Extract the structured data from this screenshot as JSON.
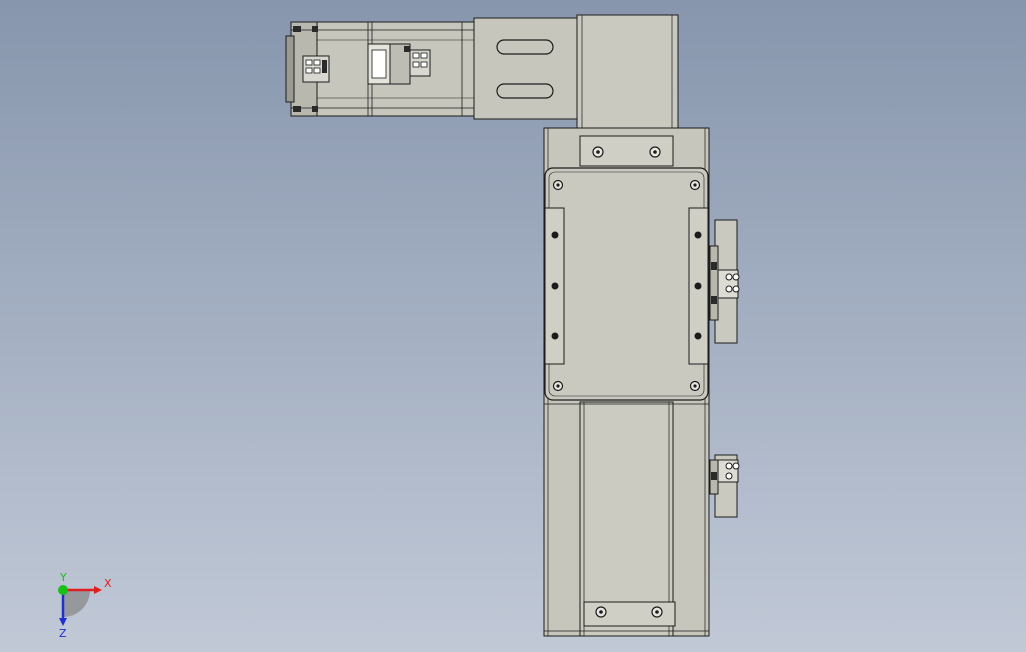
{
  "viewport": {
    "background_top": "#8796ad",
    "background_bottom": "#c1c9d7"
  },
  "model": {
    "body_color": "#c6c6bc",
    "edge_color": "#1c1c1c",
    "dark_color": "#2a2a2a"
  },
  "triad": {
    "x_label": "X",
    "y_label": "Y",
    "z_label": "Z",
    "x_color": "#e02020",
    "y_color": "#18c018",
    "z_color": "#2030d0"
  }
}
